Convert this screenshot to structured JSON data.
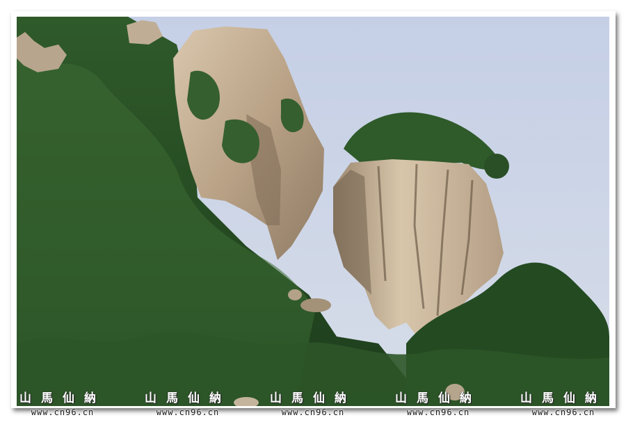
{
  "photo": {
    "subject": "granite-cliff-with-pines",
    "colors": {
      "sky": "#c8d3e8",
      "rock": "#c9b49a",
      "foliage": "#2f5a2a",
      "frame": "#ffffff"
    }
  },
  "watermarks": {
    "seal_text": "山馬仙納",
    "url": "www.cn96.cn",
    "repeat": 5
  }
}
